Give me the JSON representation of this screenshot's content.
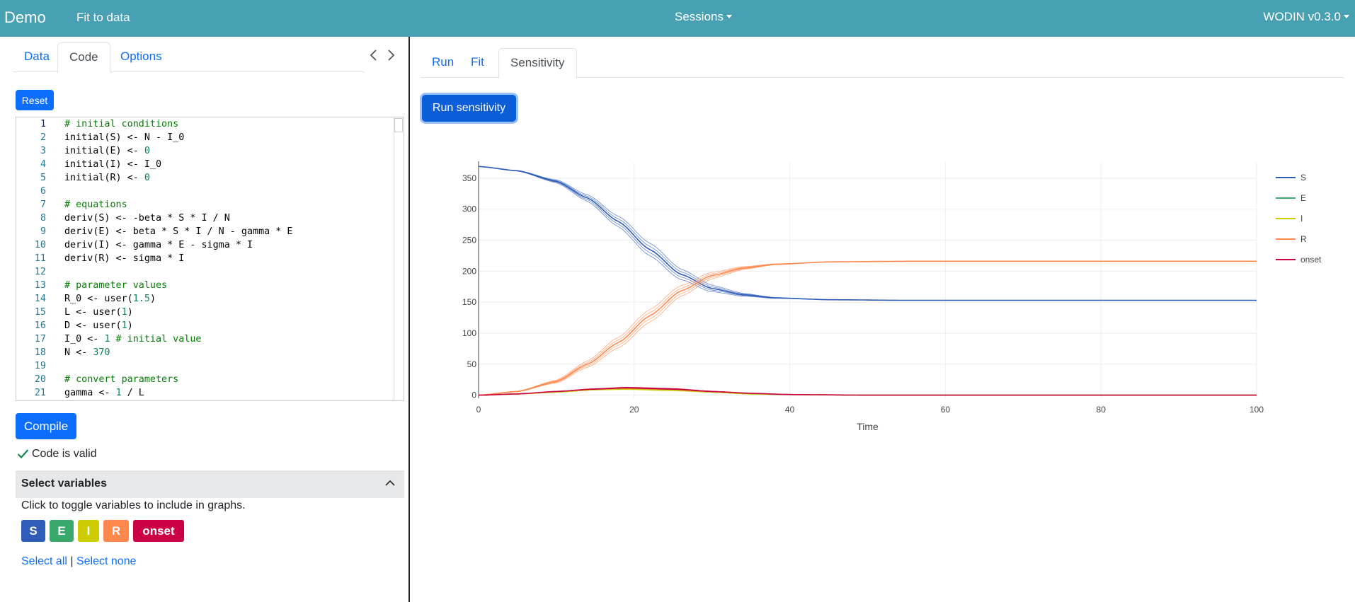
{
  "navbar": {
    "brand": "Demo",
    "app_link": "Fit to data",
    "sessions": "Sessions",
    "version": "WODIN v0.3.0"
  },
  "left_tabs": [
    "Data",
    "Code",
    "Options"
  ],
  "left_active_tab": "Code",
  "editor": {
    "reset_label": "Reset",
    "lines": [
      {
        "n": "1",
        "parts": [
          [
            "cm",
            "# initial conditions"
          ]
        ]
      },
      {
        "n": "2",
        "parts": [
          [
            "",
            "initial(S) <- N - I_0"
          ]
        ]
      },
      {
        "n": "3",
        "parts": [
          [
            "",
            "initial(E) <- "
          ],
          [
            "nm",
            "0"
          ]
        ]
      },
      {
        "n": "4",
        "parts": [
          [
            "",
            "initial(I) <- I_0"
          ]
        ]
      },
      {
        "n": "5",
        "parts": [
          [
            "",
            "initial(R) <- "
          ],
          [
            "nm",
            "0"
          ]
        ]
      },
      {
        "n": "6",
        "parts": []
      },
      {
        "n": "7",
        "parts": [
          [
            "cm",
            "# equations"
          ]
        ]
      },
      {
        "n": "8",
        "parts": [
          [
            "",
            "deriv(S) <- -beta * S * I / N"
          ]
        ]
      },
      {
        "n": "9",
        "parts": [
          [
            "",
            "deriv(E) <- beta * S * I / N - gamma * E"
          ]
        ]
      },
      {
        "n": "10",
        "parts": [
          [
            "",
            "deriv(I) <- gamma * E - sigma * I"
          ]
        ]
      },
      {
        "n": "11",
        "parts": [
          [
            "",
            "deriv(R) <- sigma * I"
          ]
        ]
      },
      {
        "n": "12",
        "parts": []
      },
      {
        "n": "13",
        "parts": [
          [
            "cm",
            "# parameter values"
          ]
        ]
      },
      {
        "n": "14",
        "parts": [
          [
            "",
            "R_0 <- user("
          ],
          [
            "nm",
            "1.5"
          ],
          [
            "",
            ")"
          ]
        ]
      },
      {
        "n": "15",
        "parts": [
          [
            "",
            "L <- user("
          ],
          [
            "nm",
            "1"
          ],
          [
            "",
            ")"
          ]
        ]
      },
      {
        "n": "16",
        "parts": [
          [
            "",
            "D <- user("
          ],
          [
            "nm",
            "1"
          ],
          [
            "",
            ")"
          ]
        ]
      },
      {
        "n": "17",
        "parts": [
          [
            "",
            "I_0 <- "
          ],
          [
            "nm",
            "1"
          ],
          [
            "cm",
            " # initial value"
          ]
        ]
      },
      {
        "n": "18",
        "parts": [
          [
            "",
            "N <- "
          ],
          [
            "nm",
            "370"
          ]
        ]
      },
      {
        "n": "19",
        "parts": []
      },
      {
        "n": "20",
        "parts": [
          [
            "cm",
            "# convert parameters"
          ]
        ]
      },
      {
        "n": "21",
        "parts": [
          [
            "",
            "gamma <- "
          ],
          [
            "nm",
            "1"
          ],
          [
            "",
            " / L"
          ]
        ]
      }
    ]
  },
  "compile": {
    "label": "Compile",
    "status": "Code is valid"
  },
  "select_variables": {
    "title": "Select variables",
    "hint": "Click to toggle variables to include in graphs.",
    "variables": [
      {
        "name": "S",
        "color": "#2e5cb8"
      },
      {
        "name": "E",
        "color": "#39a96b"
      },
      {
        "name": "I",
        "color": "#cccc00"
      },
      {
        "name": "R",
        "color": "#ff884d"
      },
      {
        "name": "onset",
        "color": "#cc0044"
      }
    ],
    "select_all": "Select all",
    "separator": "|",
    "select_none": "Select none"
  },
  "right_tabs": [
    "Run",
    "Fit",
    "Sensitivity"
  ],
  "right_active_tab": "Sensitivity",
  "run_sensitivity_label": "Run sensitivity",
  "chart_data": {
    "type": "line",
    "xlabel": "Time",
    "ylabel": "",
    "xlim": [
      0,
      100
    ],
    "ylim": [
      -5,
      375
    ],
    "xticks": [
      0,
      20,
      40,
      60,
      80,
      100
    ],
    "yticks": [
      0,
      50,
      100,
      150,
      200,
      250,
      300,
      350
    ],
    "grid": true,
    "legend_position": "right",
    "band_note_visible_in_image": false,
    "series": [
      {
        "name": "S",
        "color": "#2e5cb8",
        "x": [
          0,
          5,
          10,
          14,
          18,
          22,
          26,
          30,
          34,
          38,
          45,
          55,
          70,
          100
        ],
        "y": [
          369,
          362,
          345,
          318,
          280,
          235,
          195,
          172,
          162,
          157,
          154,
          153,
          153,
          153
        ],
        "spread": 10
      },
      {
        "name": "E",
        "color": "#39a96b",
        "x": [
          0,
          5,
          10,
          15,
          19,
          25,
          30,
          35,
          40,
          50,
          100
        ],
        "y": [
          0,
          2,
          5,
          9,
          11,
          9,
          5,
          2,
          1,
          0,
          0
        ],
        "spread": 1
      },
      {
        "name": "I",
        "color": "#cccc00",
        "x": [
          0,
          5,
          10,
          15,
          19,
          25,
          30,
          35,
          40,
          50,
          100
        ],
        "y": [
          0,
          2,
          5,
          9,
          10,
          8,
          5,
          2,
          1,
          0,
          0
        ],
        "spread": 1
      },
      {
        "name": "R",
        "color": "#ff884d",
        "x": [
          0,
          5,
          10,
          14,
          18,
          22,
          26,
          30,
          34,
          38,
          45,
          55,
          70,
          100
        ],
        "y": [
          0,
          6,
          22,
          50,
          85,
          128,
          168,
          193,
          205,
          211,
          215,
          216,
          216,
          216
        ],
        "spread": 10
      },
      {
        "name": "onset",
        "color": "#cc0044",
        "x": [
          0,
          5,
          10,
          15,
          19,
          25,
          30,
          35,
          40,
          50,
          100
        ],
        "y": [
          0,
          2,
          6,
          10,
          12,
          10,
          6,
          3,
          1,
          0,
          0
        ],
        "spread": 1
      }
    ]
  }
}
